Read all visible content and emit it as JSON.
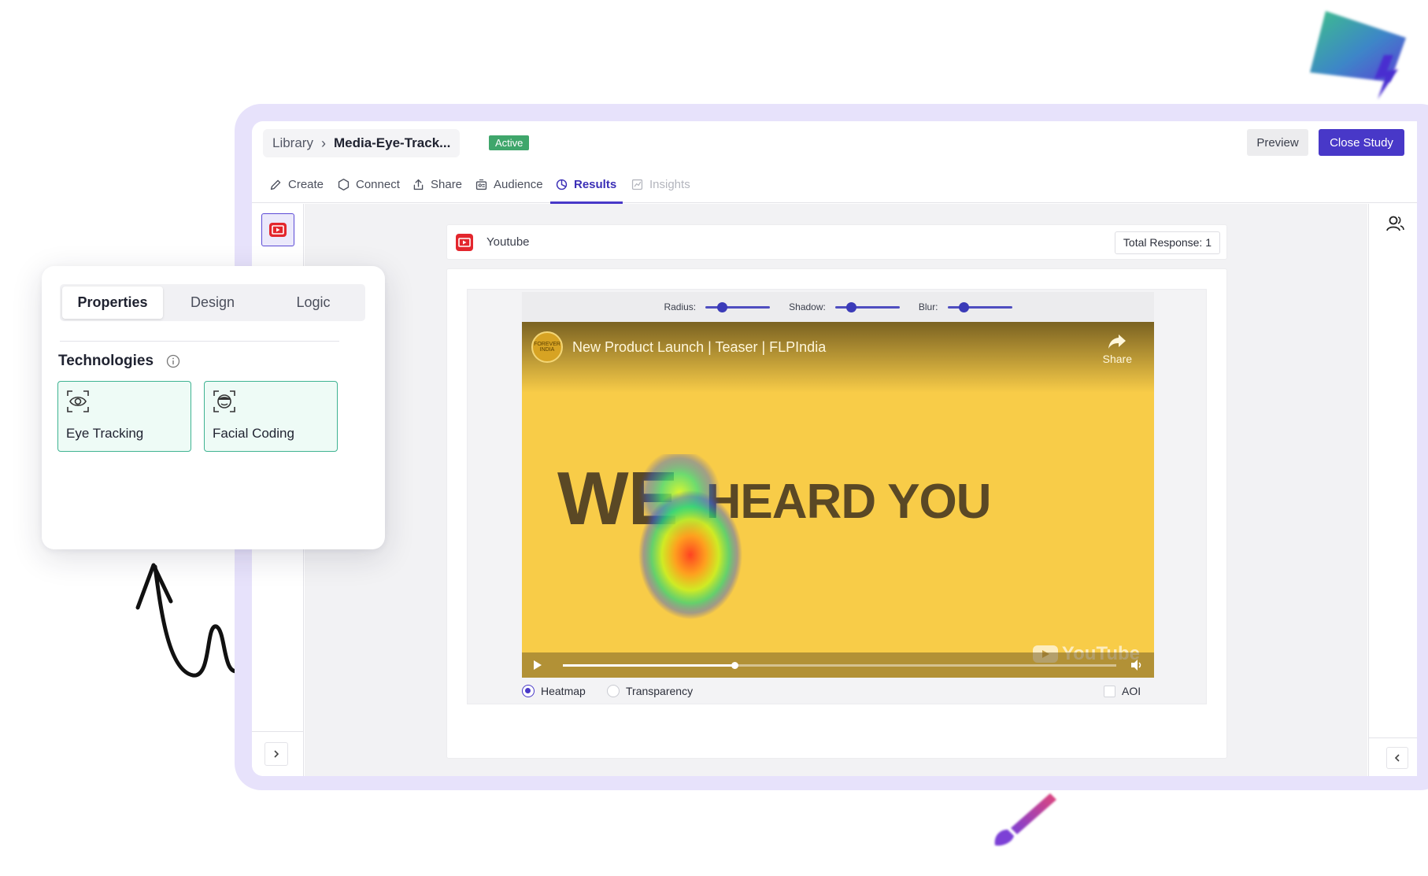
{
  "breadcrumb": {
    "library": "Library",
    "separator": "›",
    "current": "Media-Eye-Track..."
  },
  "status_badge": "Active",
  "header_actions": {
    "preview": "Preview",
    "close_study": "Close Study"
  },
  "tabs": [
    {
      "label": "Create",
      "icon": "pencil-icon",
      "state": "normal"
    },
    {
      "label": "Connect",
      "icon": "hexagon-icon",
      "state": "normal"
    },
    {
      "label": "Share",
      "icon": "share-icon",
      "state": "normal"
    },
    {
      "label": "Audience",
      "icon": "audience-icon",
      "state": "normal"
    },
    {
      "label": "Results",
      "icon": "pie-chart-icon",
      "state": "active"
    },
    {
      "label": "Insights",
      "icon": "insights-icon",
      "state": "disabled"
    }
  ],
  "media": {
    "title": "Youtube",
    "total_response": "Total Response: 1",
    "controls": {
      "radius": "Radius:",
      "shadow": "Shadow:",
      "blur": "Blur:"
    },
    "control_levels": {
      "radius": 0.25,
      "shadow": 0.25,
      "blur": 0.25
    },
    "video": {
      "title": "New Product Launch | Teaser | FLPIndia",
      "channel_logo_text": "FOREVER INDIA",
      "share": "Share",
      "headline_word1": "WE",
      "headline_word2": "HEARD YOU",
      "brand": "YouTube",
      "progress": 0.31
    },
    "options": {
      "heatmap": "Heatmap",
      "transparency": "Transparency",
      "aoi": "AOI",
      "selected": "heatmap"
    }
  },
  "properties_panel": {
    "tabs": [
      "Properties",
      "Design",
      "Logic"
    ],
    "active_tab": "Properties",
    "section_title": "Technologies",
    "technologies": [
      {
        "label": "Eye Tracking",
        "icon": "eye-tracking-icon"
      },
      {
        "label": "Facial Coding",
        "icon": "facial-coding-icon"
      }
    ]
  },
  "colors": {
    "accent": "#4838c8",
    "active_badge": "#3fa66b",
    "video_background": "#f8cc48",
    "tech_card_border": "#3fb392",
    "frame": "#e7e2fb"
  }
}
